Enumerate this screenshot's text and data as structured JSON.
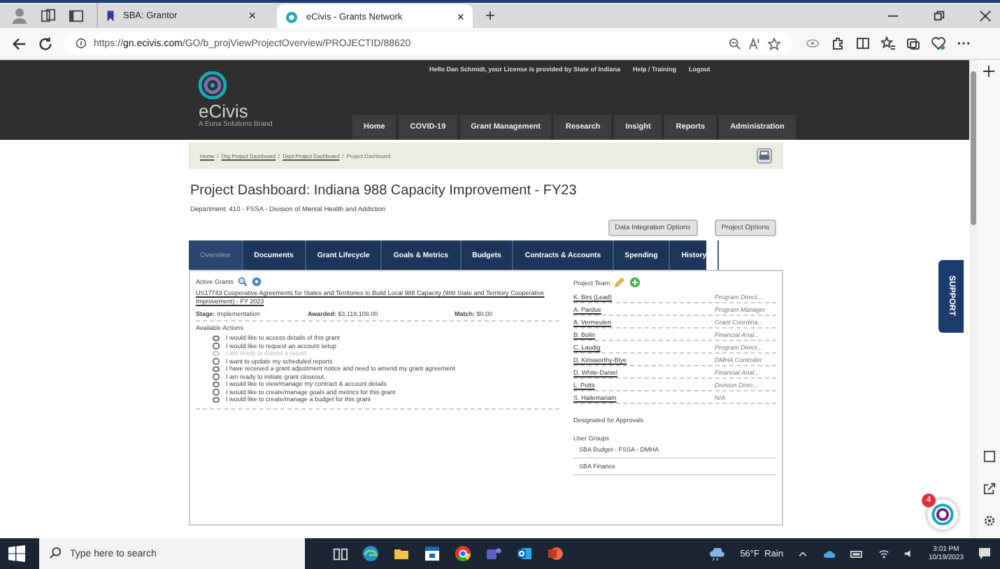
{
  "browser": {
    "tabs": [
      {
        "title": "SBA: Grantor",
        "selected": false,
        "close": "×"
      },
      {
        "title": "eCivis - Grants Network",
        "selected": true,
        "close": "×"
      }
    ],
    "new_tab": "+",
    "url_prefix": "https://",
    "url_host": "gn.ecivis.com",
    "url_path": "/GO/b_projViewProjectOverview/PROJECTID/88620"
  },
  "header": {
    "logo": "eCivis",
    "tagline": "A Euna Solutions Brand",
    "greeting": "Hello Dan Schmidt, your License is provided by State of Indiana",
    "links": [
      "Help / Training",
      "Logout"
    ],
    "nav": [
      "Home",
      "COVID-19",
      "Grant Management",
      "Research",
      "Insight",
      "Reports",
      "Administration"
    ]
  },
  "breadcrumb_separator": "/",
  "breadcrumb": [
    "Home",
    "Org Project Dashboard",
    "Dept Project Dashboard",
    "Project Dashboard"
  ],
  "title": "Project Dashboard: Indiana 988 Capacity Improvement - FY23",
  "department": "Department: 410 - FSSA - Division of Mental Health and Addiction",
  "buttons": [
    "Data Integration Options",
    "Project Options"
  ],
  "tabs": [
    {
      "label": "Overview",
      "selected": true
    },
    {
      "label": "Documents",
      "selected": false
    },
    {
      "label": "Grant Lifecycle",
      "selected": false
    },
    {
      "label": "Goals & Metrics",
      "selected": false
    },
    {
      "label": "Budgets",
      "selected": false
    },
    {
      "label": "Contracts & Accounts",
      "selected": false
    },
    {
      "label": "Spending",
      "selected": false
    },
    {
      "label": "History",
      "selected": false
    }
  ],
  "active_grants": {
    "label": "Active Grants",
    "grant": "US17743 Cooperative Agreements for States and Territories to Build Local 988 Capacity (988 State and Territory Cooperative Improvement) - FY 2023",
    "stage_label": "Stage:",
    "stage": "Implementation",
    "awarded_label": "Awarded:",
    "awarded": "$3,118,108.00",
    "match_label": "Match:",
    "match": "$0.00"
  },
  "available_actions": {
    "label": "Available Actions",
    "options": [
      {
        "text": "I would like to access details of this grant",
        "disabled": false
      },
      {
        "text": "I would like to request an account setup",
        "disabled": false
      },
      {
        "text": "I am ready to submit a report",
        "disabled": true
      },
      {
        "text": "I want to update my scheduled reports",
        "disabled": false
      },
      {
        "text": "I have received a grant adjustment notice and need to amend my grant agreement",
        "disabled": false
      },
      {
        "text": "I am ready to initiate grant closeout.",
        "disabled": false
      },
      {
        "text": "I would like to view/manage my contract & account details",
        "disabled": false
      },
      {
        "text": "I would like to create/manage goals and metrics for this grant",
        "disabled": false
      },
      {
        "text": "I would like to create/manage a budget for this grant",
        "disabled": false
      }
    ]
  },
  "project_team": {
    "label": "Project Team",
    "members": [
      {
        "name": "K. Birs (Lead)",
        "role": "Program Direct..."
      },
      {
        "name": "A. Pardue",
        "role": "Program Manager"
      },
      {
        "name": "A. Vermeulen",
        "role": "Grant Coordina..."
      },
      {
        "name": "B. Bolin",
        "role": "Financial Anal..."
      },
      {
        "name": "C. Laudig",
        "role": "Program Direct..."
      },
      {
        "name": "D. Kinsworthy-Blye",
        "role": "DMHA Controller"
      },
      {
        "name": "D. White-Daniel",
        "role": "Financial Anal..."
      },
      {
        "name": "L. Potts",
        "role": "Division Direc..."
      },
      {
        "name": "S. Hailemariam",
        "role": "N/A"
      }
    ],
    "approvals": "Designated for Approvals",
    "groups_label": "User Groups",
    "groups": [
      "SBA Budget - FSSA - DMHA",
      "SBA Finance"
    ]
  },
  "support": "SUPPORT",
  "chat_badge": "4",
  "taskbar": {
    "search_placeholder": "Type here to search",
    "weather": "56°F  Rain",
    "time": "3:01 PM",
    "date": "10/19/2023"
  }
}
